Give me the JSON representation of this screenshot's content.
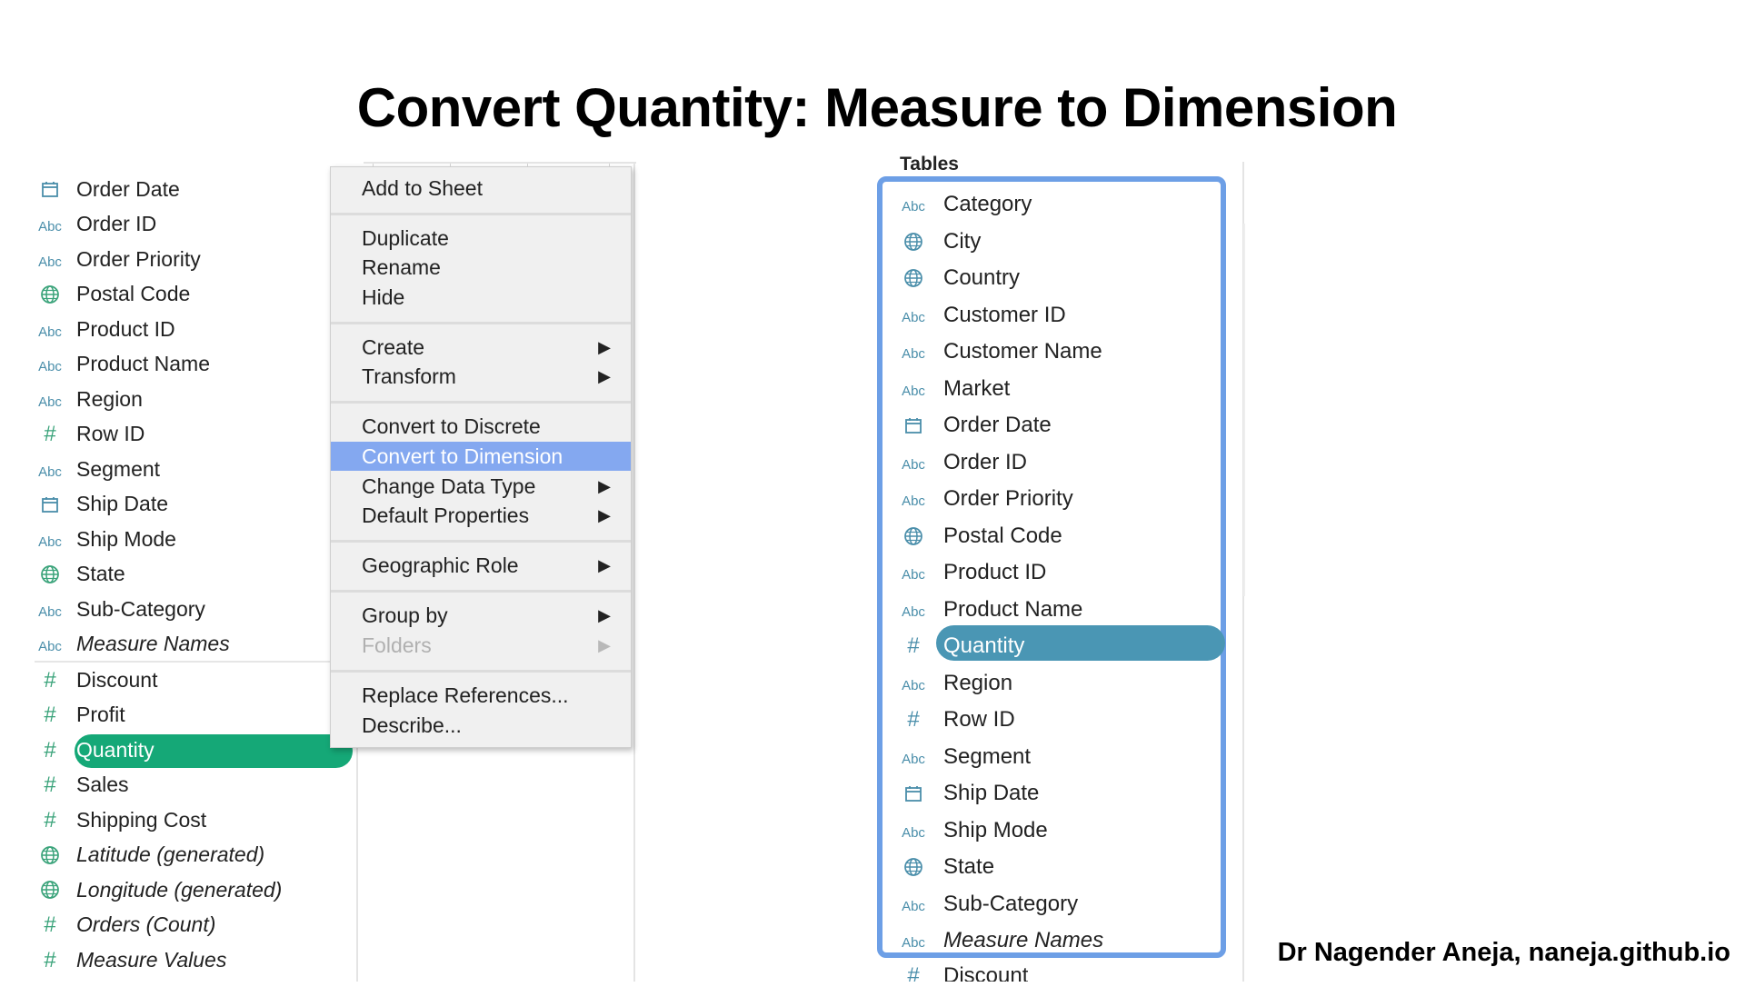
{
  "slide": {
    "title": "Convert Quantity: Measure to Dimension",
    "author": "Dr Nagender Aneja, naneja.github.io"
  },
  "left_pane": {
    "dimensions": [
      {
        "icon": "calendar-icon",
        "label": "Order Date"
      },
      {
        "icon": "abc-icon",
        "label": "Order ID"
      },
      {
        "icon": "abc-icon",
        "label": "Order Priority"
      },
      {
        "icon": "globe-icon",
        "label": "Postal Code"
      },
      {
        "icon": "abc-icon",
        "label": "Product ID"
      },
      {
        "icon": "abc-icon",
        "label": "Product Name"
      },
      {
        "icon": "abc-icon",
        "label": "Region"
      },
      {
        "icon": "hash-icon",
        "label": "Row ID"
      },
      {
        "icon": "abc-icon",
        "label": "Segment"
      },
      {
        "icon": "calendar-icon",
        "label": "Ship Date"
      },
      {
        "icon": "abc-icon",
        "label": "Ship Mode"
      },
      {
        "icon": "globe-icon",
        "label": "State"
      },
      {
        "icon": "abc-icon",
        "label": "Sub-Category"
      },
      {
        "icon": "abc-icon",
        "label": "Measure Names"
      }
    ],
    "measures": [
      {
        "icon": "hash-icon",
        "label": "Discount"
      },
      {
        "icon": "hash-icon",
        "label": "Profit"
      },
      {
        "icon": "hash-icon",
        "label": "Quantity",
        "selected": true
      },
      {
        "icon": "hash-icon",
        "label": "Sales"
      },
      {
        "icon": "hash-icon",
        "label": "Shipping Cost"
      },
      {
        "icon": "globe-icon",
        "label": "Latitude (generated)"
      },
      {
        "icon": "globe-icon",
        "label": "Longitude (generated)"
      },
      {
        "icon": "hash-icon",
        "label": "Orders (Count)"
      },
      {
        "icon": "hash-icon",
        "label": "Measure Values"
      }
    ]
  },
  "context_menu": {
    "add_to_sheet": "Add to Sheet",
    "duplicate": "Duplicate",
    "rename": "Rename",
    "hide": "Hide",
    "create": "Create",
    "transform": "Transform",
    "convert_discrete": "Convert to Discrete",
    "convert_dimension": "Convert to Dimension",
    "change_data_type": "Change Data Type",
    "default_properties": "Default Properties",
    "geographic_role": "Geographic Role",
    "group_by": "Group by",
    "folders": "Folders",
    "replace_references": "Replace References...",
    "describe": "Describe...",
    "submenu_arrow": "▶"
  },
  "right_pane": {
    "tables_label": "Tables",
    "fields": [
      {
        "icon": "abc-icon",
        "label": "Category"
      },
      {
        "icon": "globe-icon",
        "label": "City"
      },
      {
        "icon": "globe-icon",
        "label": "Country"
      },
      {
        "icon": "abc-icon",
        "label": "Customer ID"
      },
      {
        "icon": "abc-icon",
        "label": "Customer Name"
      },
      {
        "icon": "abc-icon",
        "label": "Market"
      },
      {
        "icon": "calendar-icon",
        "label": "Order Date"
      },
      {
        "icon": "abc-icon",
        "label": "Order ID"
      },
      {
        "icon": "abc-icon",
        "label": "Order Priority"
      },
      {
        "icon": "globe-icon",
        "label": "Postal Code"
      },
      {
        "icon": "abc-icon",
        "label": "Product ID"
      },
      {
        "icon": "abc-icon",
        "label": "Product Name"
      },
      {
        "icon": "hash-icon",
        "label": "Quantity",
        "selected": true
      },
      {
        "icon": "abc-icon",
        "label": "Region"
      },
      {
        "icon": "hash-icon",
        "label": "Row ID"
      },
      {
        "icon": "abc-icon",
        "label": "Segment"
      },
      {
        "icon": "calendar-icon",
        "label": "Ship Date"
      },
      {
        "icon": "abc-icon",
        "label": "Ship Mode"
      },
      {
        "icon": "globe-icon",
        "label": "State"
      },
      {
        "icon": "abc-icon",
        "label": "Sub-Category"
      },
      {
        "icon": "abc-icon",
        "label": "Measure Names"
      }
    ],
    "peek_label": "Discount"
  },
  "icon_text": {
    "abc": "Abc",
    "hash": "#"
  },
  "colors": {
    "selected_left": "#15a877",
    "selected_right": "#4a96b4",
    "menu_highlight": "#84a8f0",
    "box_border": "#6d9fe6"
  }
}
